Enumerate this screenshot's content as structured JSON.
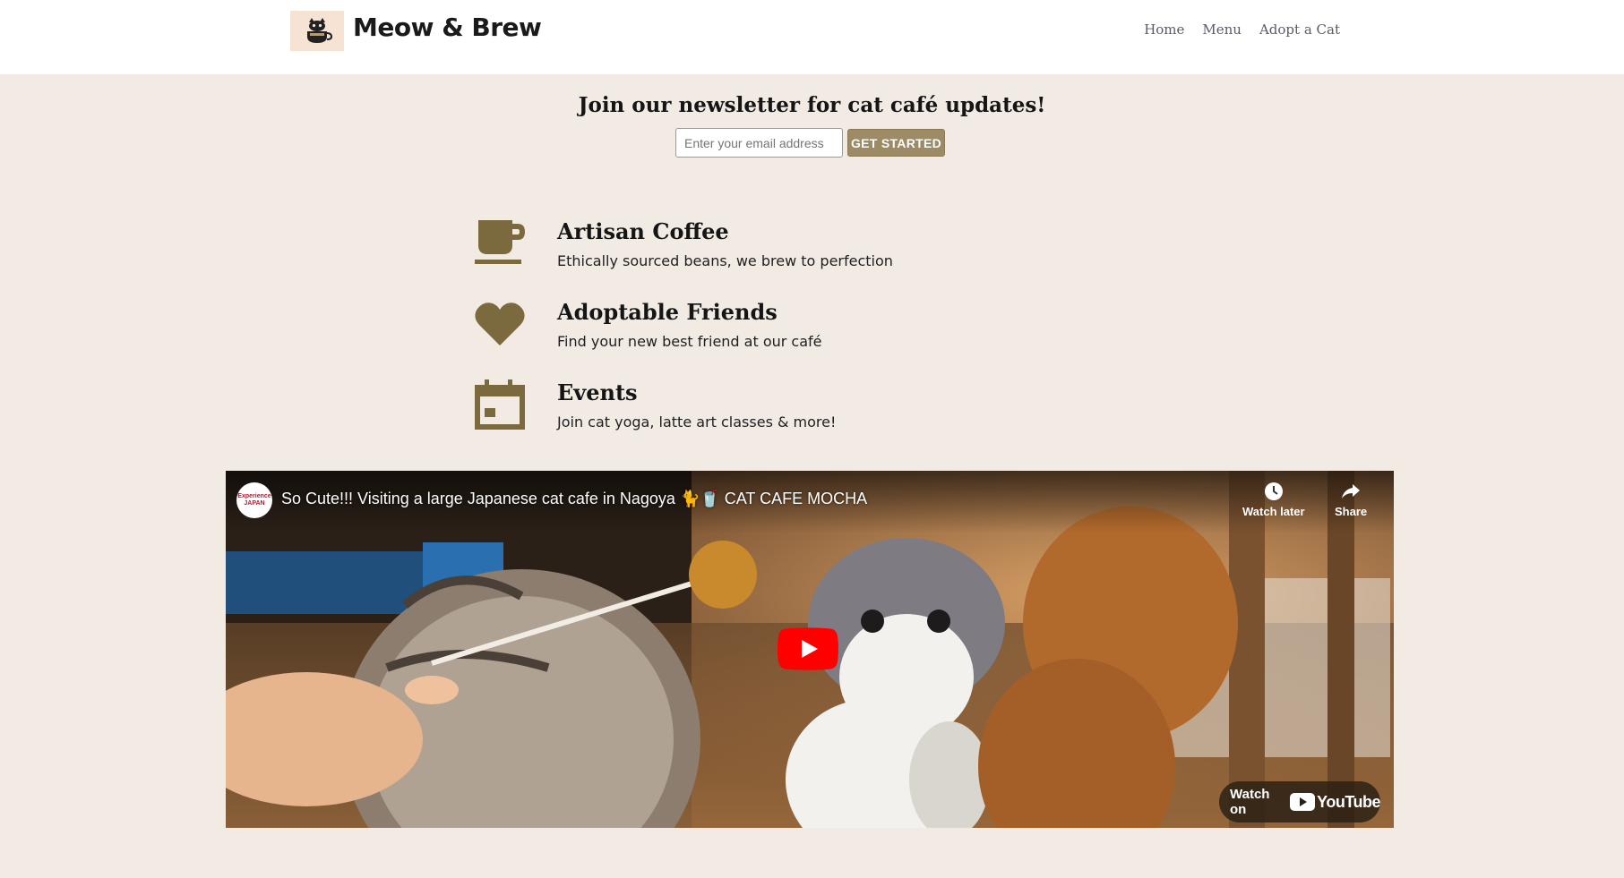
{
  "header": {
    "brand": "Meow & Brew",
    "logo_icon": "cat-coffee-cup-icon",
    "nav": [
      {
        "label": "Home"
      },
      {
        "label": "Menu"
      },
      {
        "label": "Adopt a Cat"
      }
    ]
  },
  "newsletter": {
    "title": "Join our newsletter for cat café updates!",
    "email_placeholder": "Enter your email address",
    "email_value": "",
    "button_label": "GET STARTED"
  },
  "features": [
    {
      "icon": "coffee-cup-icon",
      "title": "Artisan Coffee",
      "description": "Ethically sourced beans, we brew to perfection"
    },
    {
      "icon": "heart-icon",
      "title": "Adoptable Friends",
      "description": "Find your new best friend at our café"
    },
    {
      "icon": "calendar-icon",
      "title": "Events",
      "description": "Join cat yoga, latte art classes & more!"
    }
  ],
  "video": {
    "channel_avatar_line1": "Experience",
    "channel_avatar_line2": "JAPAN",
    "title": "So Cute!!! Visiting a large Japanese cat cafe in Nagoya 🐈🥤 CAT CAFE MOCHA",
    "watch_later_label": "Watch later",
    "share_label": "Share",
    "watch_on_label": "Watch on",
    "youtube_label": "YouTube"
  },
  "colors": {
    "page_bg": "#f1ebe4",
    "accent": "#9c8b64",
    "icon_brown": "#7a6a3e",
    "youtube_red": "#ff0000"
  }
}
